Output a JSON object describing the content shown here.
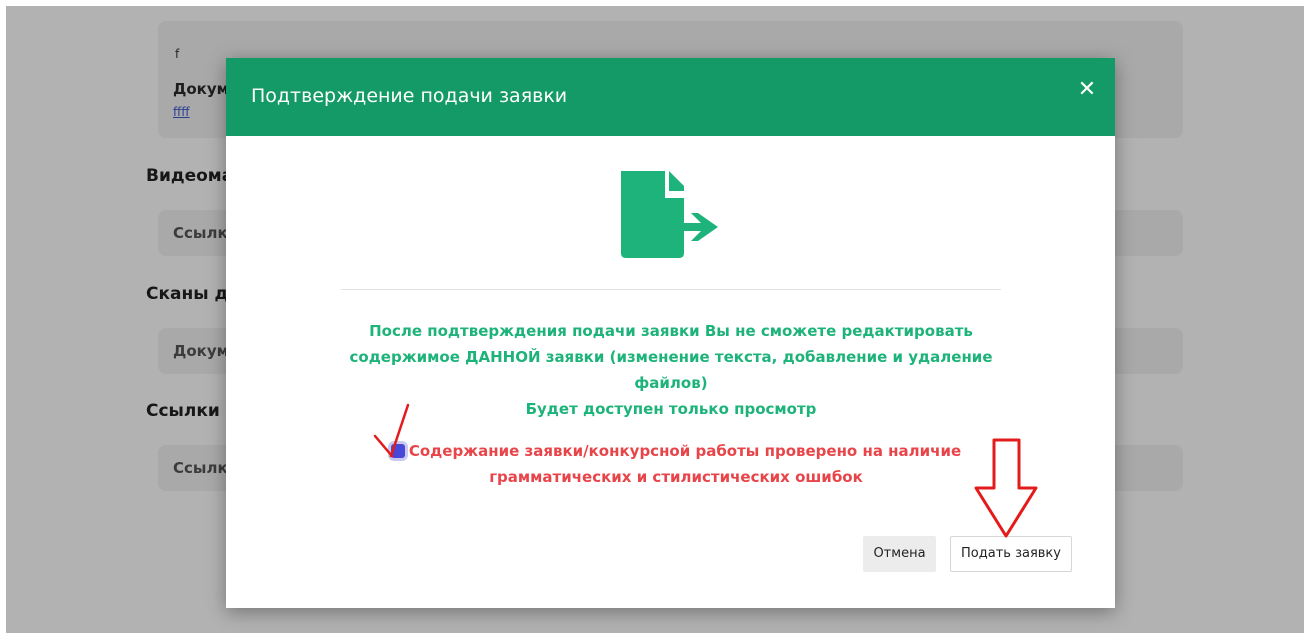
{
  "background": {
    "card1": {
      "small_text": "f",
      "doc_label": "Документы",
      "file_link": "ffff"
    },
    "sections": [
      {
        "title": "Видеоматериалы",
        "field": "Ссылки"
      },
      {
        "title": "Сканы документов",
        "field": "Документы"
      },
      {
        "title": "Ссылки",
        "field": "Ссылки"
      }
    ]
  },
  "modal": {
    "title": "Подтверждение подачи заявки",
    "close_icon": "close-icon",
    "icon": "file-export-icon",
    "warning_lines": [
      "После подтверждения подачи заявки Вы не сможете редактировать",
      "содержимое ДАННОЙ заявки (изменение текста, добавление и удаление",
      "файлов)",
      "Будет доступен только просмотр"
    ],
    "confirm_checked": true,
    "confirm_line1": "Содержание заявки/конкурсной работы проверено на наличие",
    "confirm_line2": "грамматических и стилистических ошибок",
    "cancel_label": "Отмена",
    "submit_label": "Подать заявку"
  },
  "colors": {
    "header": "#149a66",
    "icon": "#1db37a",
    "warning_text": "#1db37a",
    "confirm_text": "#e8454a",
    "annotation": "#e31b1b"
  }
}
